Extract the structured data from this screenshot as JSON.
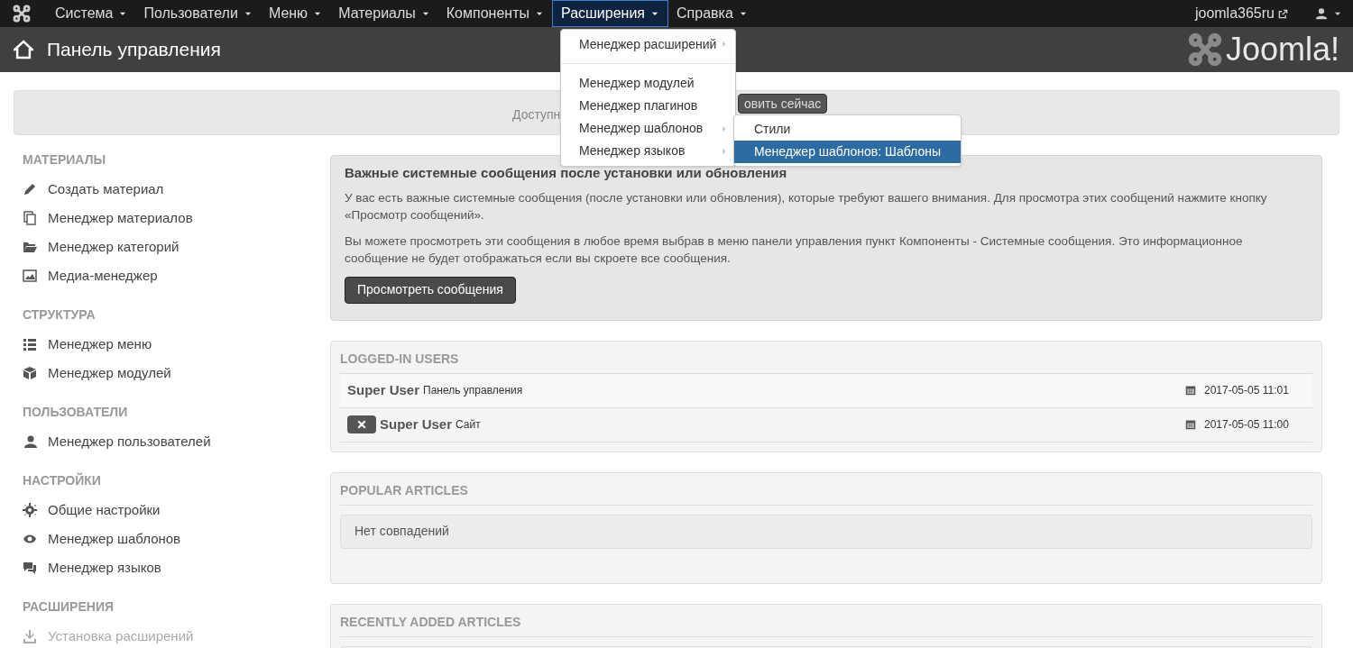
{
  "navbar": {
    "items": [
      {
        "label": "Система",
        "selected": false
      },
      {
        "label": "Пользователи",
        "selected": false
      },
      {
        "label": "Меню",
        "selected": false
      },
      {
        "label": "Материалы",
        "selected": false
      },
      {
        "label": "Компоненты",
        "selected": false
      },
      {
        "label": "Расширения",
        "selected": true
      },
      {
        "label": "Справка",
        "selected": false
      }
    ],
    "site_link": "joomla365ru"
  },
  "header": {
    "title": "Панель управления",
    "logo_text": "Joomla!"
  },
  "update_alert": {
    "text": "Доступн",
    "button": "овить сейчас"
  },
  "dropdown": {
    "items": [
      {
        "kind": "item",
        "label": "Менеджер расширений",
        "submenu": true
      },
      {
        "kind": "divider"
      },
      {
        "kind": "item",
        "label": "Менеджер модулей",
        "submenu": false
      },
      {
        "kind": "item",
        "label": "Менеджер плагинов",
        "submenu": false
      },
      {
        "kind": "item",
        "label": "Менеджер шаблонов",
        "submenu": true
      },
      {
        "kind": "item",
        "label": "Менеджер языков",
        "submenu": true
      }
    ],
    "submenu": [
      {
        "label": "Стили",
        "selected": false
      },
      {
        "label": "Менеджер шаблонов: Шаблоны",
        "selected": true
      }
    ]
  },
  "sidebar": {
    "sections": [
      {
        "heading": "МАТЕРИАЛЫ",
        "items": [
          {
            "label": "Создать материал",
            "disabled": false
          },
          {
            "label": "Менеджер материалов",
            "disabled": false
          },
          {
            "label": "Менеджер категорий",
            "disabled": false
          },
          {
            "label": "Медиа-менеджер",
            "disabled": false
          }
        ]
      },
      {
        "heading": "СТРУКТУРА",
        "items": [
          {
            "label": "Менеджер меню",
            "disabled": false
          },
          {
            "label": "Менеджер модулей",
            "disabled": false
          }
        ]
      },
      {
        "heading": "ПОЛЬЗОВАТЕЛИ",
        "items": [
          {
            "label": "Менеджер пользователей",
            "disabled": false
          }
        ]
      },
      {
        "heading": "НАСТРОЙКИ",
        "items": [
          {
            "label": "Общие настройки",
            "disabled": false
          },
          {
            "label": "Менеджер шаблонов",
            "disabled": false
          },
          {
            "label": "Менеджер языков",
            "disabled": false
          }
        ]
      },
      {
        "heading": "РАСШИРЕНИЯ",
        "items": [
          {
            "label": "Установка расширений",
            "disabled": true
          }
        ]
      }
    ]
  },
  "messages": {
    "title": "Важные системные сообщения после установки или обновления",
    "paragraphs": [
      "У вас есть важные системные сообщения (после установки или обновления), которые требуют вашего внимания. Для просмотра этих сообщений нажмите кнопку «Просмотр сообщений».",
      "Вы можете просмотреть эти сообщения в любое время выбрав в меню панели управления пункт Компоненты - Системные сообщения. Это информационное сообщение не будет отображаться если вы скроете все сообщения."
    ],
    "button": "Просмотреть сообщения"
  },
  "logged_in": {
    "title": "LOGGED-IN USERS",
    "rows": [
      {
        "user": "Super User",
        "place": "Панель управления",
        "time": "2017-05-05 11:01",
        "logout": false
      },
      {
        "user": "Super User",
        "place": "Сайт",
        "time": "2017-05-05 11:00",
        "logout": true
      }
    ]
  },
  "popular": {
    "title": "POPULAR ARTICLES",
    "empty": "Нет совпадений"
  },
  "recent": {
    "title": "RECENTLY ADDED ARTICLES"
  }
}
